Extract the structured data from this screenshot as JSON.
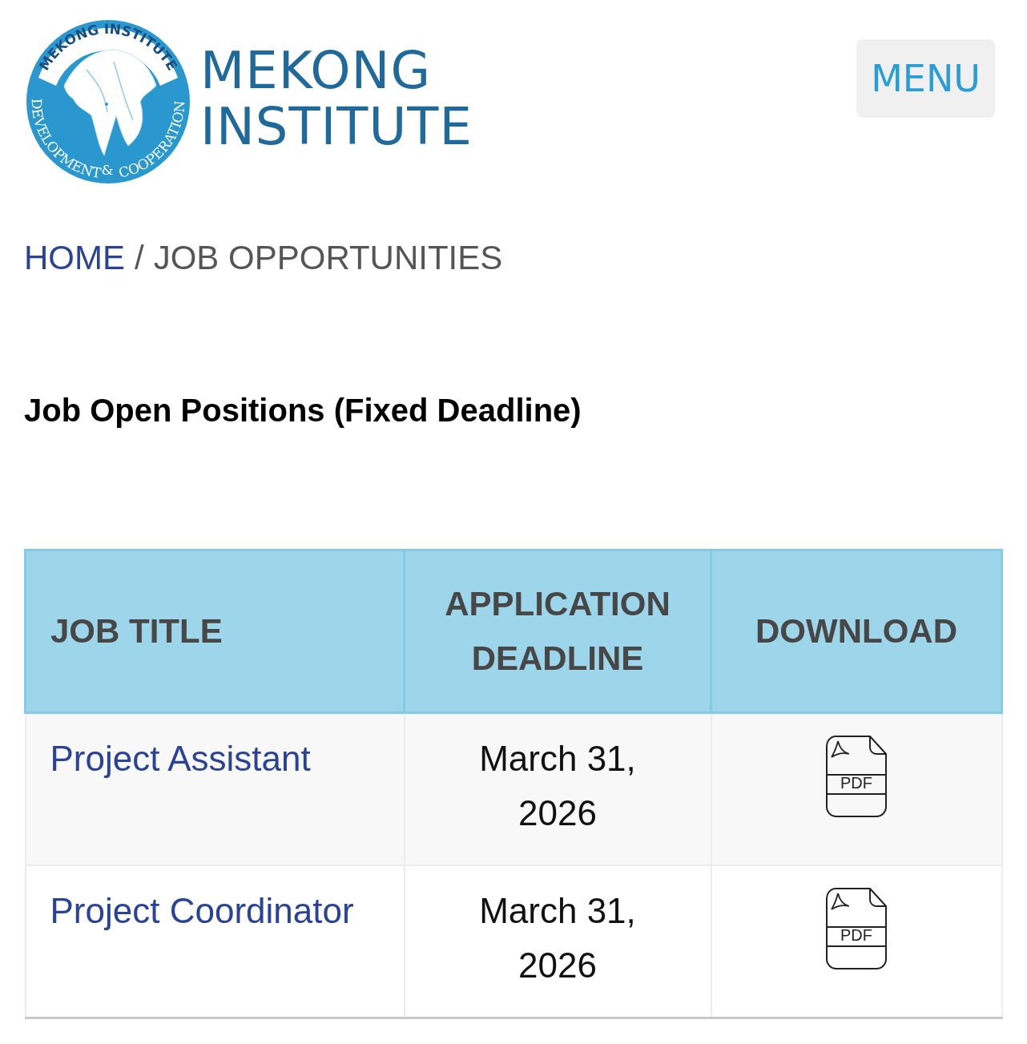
{
  "header": {
    "logo": {
      "ring_top": "MEKONG INSTITUTE",
      "ring_left": "DEVELOPMENT",
      "ring_amp": "&",
      "ring_right": "COOPERATION",
      "name_lines": [
        "MEKONG",
        "INSTITUTE"
      ]
    },
    "menu_button": "MENU"
  },
  "breadcrumb": [
    {
      "label": "HOME",
      "kind": "link"
    },
    {
      "label": "/",
      "kind": "separator"
    },
    {
      "label": "JOB OPPORTUNITIES",
      "kind": "current"
    }
  ],
  "heading": "Job Open Positions (Fixed Deadline)",
  "table": {
    "columns": [
      "JOB TITLE",
      "APPLICATION DEADLINE",
      "DOWNLOAD"
    ],
    "rows": [
      {
        "title": "Project Assistant",
        "deadline": "March 31, 2026",
        "download": "PDF"
      },
      {
        "title": "Project Coordinator",
        "deadline": "March 31, 2026",
        "download": "PDF"
      }
    ]
  }
}
